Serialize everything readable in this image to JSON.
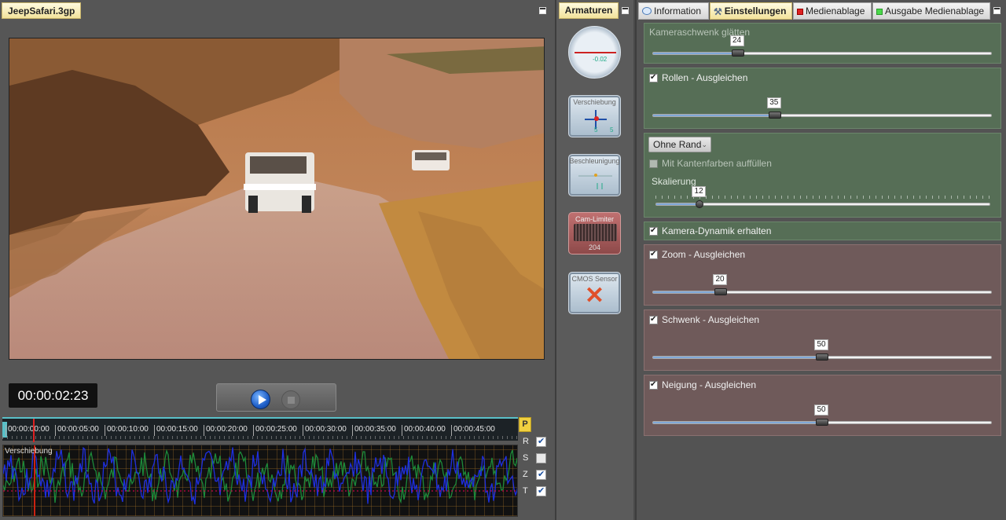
{
  "video_panel": {
    "tab_label": "JeepSafari.3gp",
    "timecode": "00:00:02:23"
  },
  "timeline": {
    "ticks": [
      "00:00:00:00",
      "00:00:05:00",
      "00:00:10:00",
      "00:00:15:00",
      "00:00:20:00",
      "00:00:25:00",
      "00:00:30:00",
      "00:00:35:00",
      "00:00:40:00",
      "00:00:45:00"
    ],
    "p_badge": "P"
  },
  "graph": {
    "label": "Verschiebung",
    "axes": [
      {
        "label": "R",
        "checked": true
      },
      {
        "label": "S",
        "checked": false
      },
      {
        "label": "Z",
        "checked": true
      },
      {
        "label": "T",
        "checked": true
      }
    ]
  },
  "instruments": {
    "tab_label": "Armaturen",
    "gauge_readout": "-0.02",
    "shift_label": "Verschiebung",
    "shift_readout_x": "5",
    "shift_readout_y": "5",
    "accel_label": "Beschleunigung",
    "limiter_label": "Cam-Limiter",
    "limiter_value": "204",
    "sensor_label": "CMOS Sensor"
  },
  "tabs": [
    {
      "label": "Information",
      "icon": "speech-bubble-icon",
      "active": false
    },
    {
      "label": "Einstellungen",
      "icon": "tools-icon",
      "active": true
    },
    {
      "label": "Medienablage",
      "icon": "red-square-icon",
      "active": false
    },
    {
      "label": "Ausgabe Medienablage",
      "icon": "green-square-icon",
      "active": false
    }
  ],
  "settings": {
    "kameraschwenk": {
      "title": "Kameraschwenk glätten",
      "value": "24",
      "fraction": 0.25
    },
    "rollen": {
      "title": "Rollen - Ausgleichen",
      "checked": true,
      "value": "35",
      "fraction": 0.36
    },
    "rand": {
      "dropdown": "Ohne Rand",
      "fill_label": "Mit Kantenfarben auffüllen",
      "fill_checked": false,
      "scale_label": "Skalierung",
      "scale_value": "12",
      "scale_fraction": 0.13
    },
    "dynamik": {
      "title": "Kamera-Dynamik erhalten",
      "checked": true
    },
    "zoom": {
      "title": "Zoom - Ausgleichen",
      "checked": true,
      "value": "20",
      "fraction": 0.2
    },
    "schwenk": {
      "title": "Schwenk - Ausgleichen",
      "checked": true,
      "value": "50",
      "fraction": 0.5
    },
    "neigung": {
      "title": "Neigung - Ausgleichen",
      "checked": true,
      "value": "50",
      "fraction": 0.5
    }
  },
  "colors": {
    "active_tab": "#f2e29b",
    "green_section": "#566e56",
    "red_section": "#6f5a5a",
    "timeline_accent": "#5ac0c8"
  }
}
